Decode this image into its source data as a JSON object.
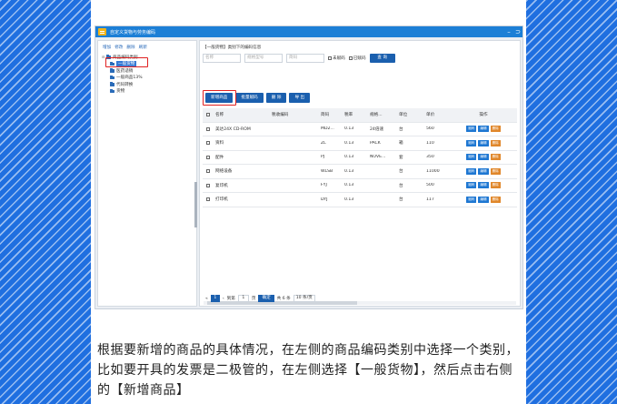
{
  "window": {
    "title": "自定义货物与劳务编码",
    "minimize": "–",
    "restore": "⊃"
  },
  "left": {
    "toolbar": [
      "增加",
      "修改",
      "删除",
      "刷新"
    ],
    "tree": [
      {
        "label": "商品编码类别",
        "level": 0,
        "toggle": "⊟"
      },
      {
        "label": "一般货物",
        "level": 1,
        "selected": true
      },
      {
        "label": "医药适销",
        "level": 1
      },
      {
        "label": "一般商品13%",
        "level": 1
      },
      {
        "label": "代码转换",
        "level": 1
      },
      {
        "label": "货物",
        "level": 1
      }
    ]
  },
  "right": {
    "title": "【一般货物】类别下的编码信息",
    "filters": {
      "name_ph": "名称",
      "model_ph": "规格型号",
      "short_ph": "简码",
      "unassigned": "未赋码",
      "assigned": "已赋码",
      "search": "查 询"
    },
    "actions": [
      "新增商品",
      "批量赋码",
      "删 除",
      "导 出"
    ],
    "columns": [
      "名称",
      "税收编码",
      "简码",
      "税率",
      "规格...",
      "单位",
      "单价",
      "操作"
    ],
    "rows": [
      {
        "name": "美达24X CD-ROM",
        "tax": "",
        "short": "MD2...",
        "rate": "0.13",
        "spec": "24倍速",
        "unit": "台",
        "price": "560"
      },
      {
        "name": "资料",
        "tax": "",
        "short": "ZL",
        "rate": "0.13",
        "spec": "PACK",
        "unit": "箱",
        "price": "110"
      },
      {
        "name": "配件",
        "tax": "",
        "short": "PJ",
        "rate": "0.13",
        "spec": "NOVE...",
        "unit": "套",
        "price": "350"
      },
      {
        "name": "网络设备",
        "tax": "",
        "short": "WLSB",
        "rate": "0.13",
        "spec": "",
        "unit": "台",
        "price": "11000"
      },
      {
        "name": "复印机",
        "tax": "",
        "short": "FYJ",
        "rate": "0.13",
        "spec": "",
        "unit": "台",
        "price": "500"
      },
      {
        "name": "打印机",
        "tax": "",
        "short": "DYJ",
        "rate": "0.13",
        "spec": "",
        "unit": "台",
        "price": "117"
      }
    ],
    "ops": [
      "赋码",
      "编辑",
      "删除"
    ],
    "pager": {
      "first": "«",
      "current": "1",
      "prev": "‹",
      "goto_label": "到第",
      "page_input": "1",
      "page_unit": "页",
      "go": "确定",
      "total": "共 6 条",
      "page_size": "10 条/页"
    }
  },
  "caption": "根据要新增的商品的具体情况，在左侧的商品编码类别中选择一个类别，比如要开具的发票是二极管的，在左侧选择【一般货物】，然后点击右侧的【新增商品】"
}
